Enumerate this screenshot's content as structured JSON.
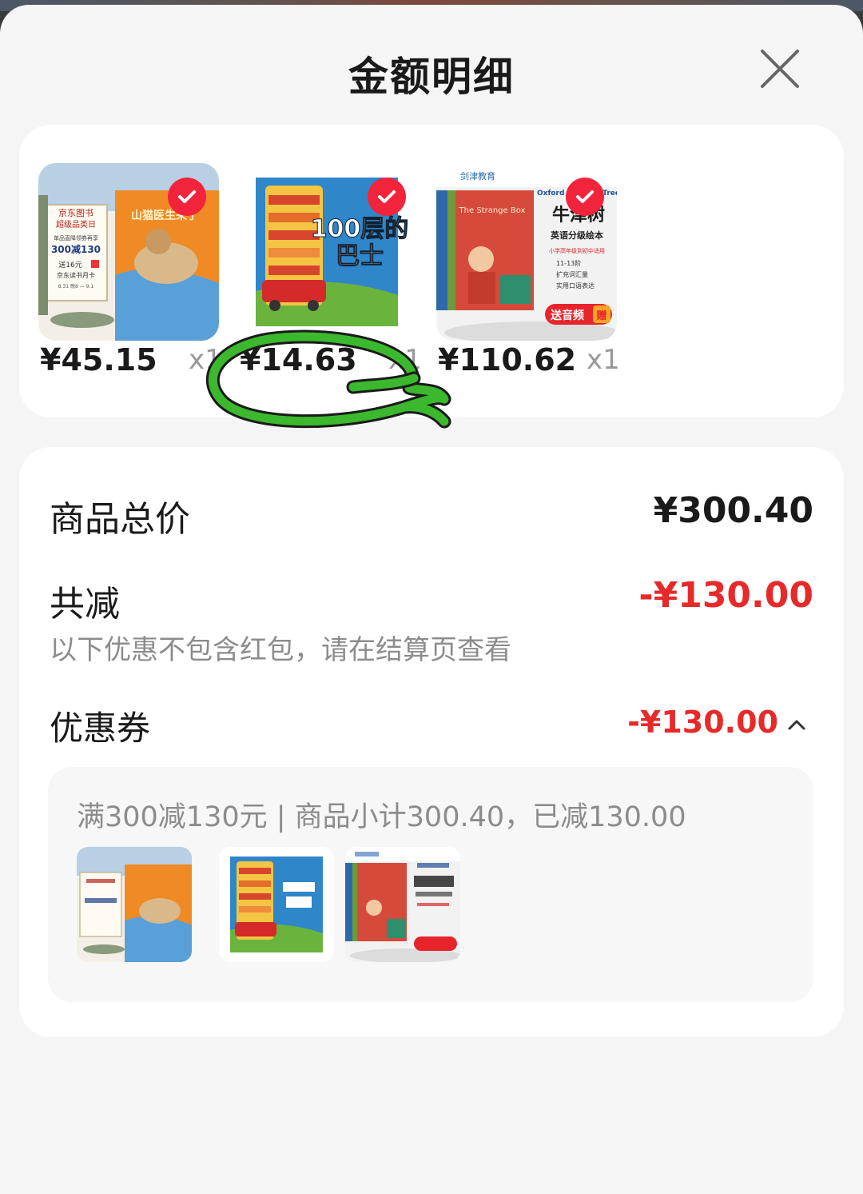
{
  "header": {
    "title": "金额明细",
    "close_icon": "close-icon"
  },
  "products": [
    {
      "price": "¥45.15",
      "qty": "x1",
      "cover": {
        "badge": "京东图书",
        "line2": "超级品类日",
        "line3": "单品直降领券再享",
        "deal": "300减130",
        "gift": "送16元",
        "gift2": "京东读书月卡",
        "date": "8.31 晚8 — 9.1",
        "title": "山猫医生来了"
      },
      "selected": true
    },
    {
      "price": "¥14.63",
      "qty": "x1",
      "cover": {
        "title_num": "100层的",
        "title_cn": "巴士"
      },
      "selected": true
    },
    {
      "price": "¥110.62",
      "qty": "x1",
      "cover": {
        "brand": "剑津教育",
        "series_en": "Oxford Reading Tree",
        "book": "The Strange Box",
        "title": "牛津树",
        "subtitle": "英语分级绘本",
        "tag": "小学高年级到初中适用",
        "b1": "11-13阶",
        "b2": "扩充词汇量",
        "b3": "实用口语表达",
        "promo": "送音频",
        "gift": "赠"
      },
      "selected": true
    }
  ],
  "summary": {
    "total_label": "商品总价",
    "total_value": "¥300.40",
    "discount_label": "共减",
    "discount_value": "-¥130.00",
    "note": "以下优惠不包含红包，请在结算页查看",
    "coupon_label": "优惠券",
    "coupon_value": "-¥130.00",
    "coupon_detail": "满300减130元 | 商品小计300.40，已减130.00"
  },
  "colors": {
    "accent_red": "#e62a2a",
    "check_red": "#f2243c",
    "annotation_green": "#3bb82e"
  }
}
